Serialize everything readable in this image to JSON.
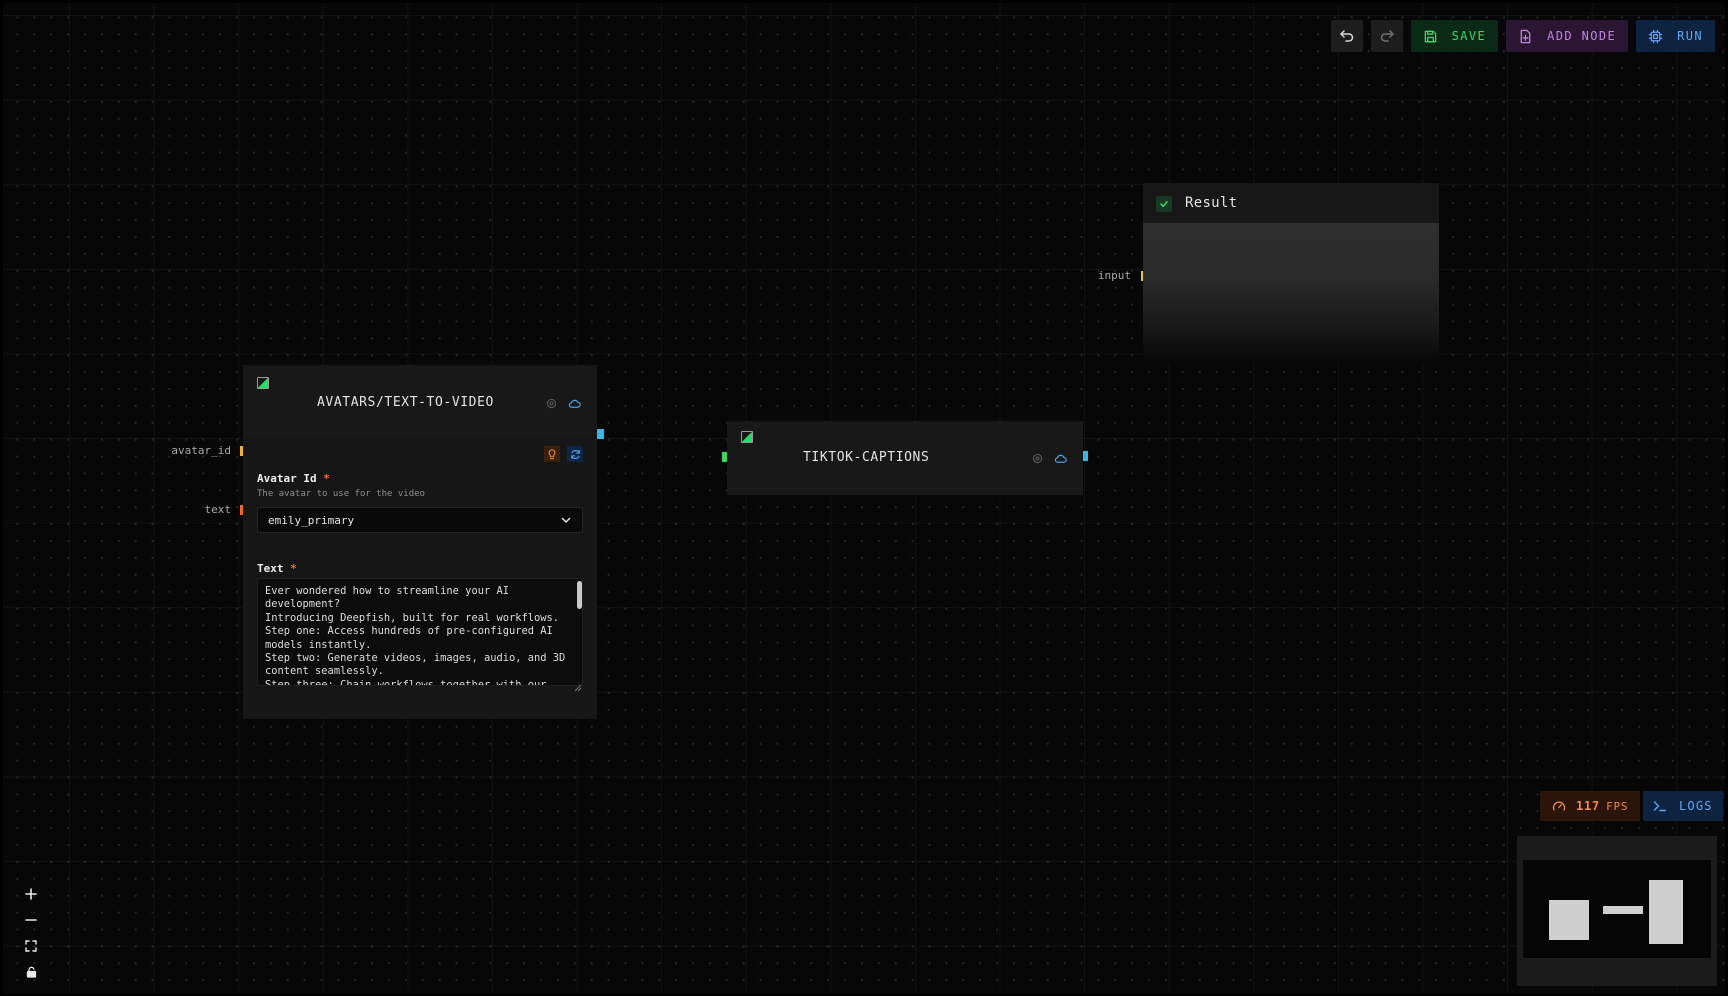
{
  "toolbar": {
    "undo_icon": "undo-icon",
    "redo_icon": "redo-icon",
    "save_label": "SAVE",
    "add_node_label": "ADD NODE",
    "run_label": "RUN"
  },
  "nodes": {
    "text_to_video": {
      "title": "AVATARS/TEXT-TO-VIDEO",
      "inputs": [
        {
          "label": "avatar_id",
          "color": "#f2b23a"
        },
        {
          "label": "text",
          "color": "#ef6a2a"
        }
      ],
      "output_color": "#35b8e8",
      "fields": {
        "avatar": {
          "label": "Avatar Id",
          "required_mark": "*",
          "description": "The avatar to use for the video",
          "value": "emily_primary"
        },
        "text": {
          "label": "Text",
          "required_mark": "*",
          "value": "Ever wondered how to streamline your AI\ndevelopment?\nIntroducing Deepfish, built for real workflows.\nStep one: Access hundreds of pre-configured AI\nmodels instantly.\nStep two: Generate videos, images, audio, and 3D\ncontent seamlessly.\nStep three: Chain workflows together with our"
        }
      }
    },
    "tiktok_captions": {
      "title": "TIKTOK-CAPTIONS",
      "input_color": "#3ed65a",
      "output_color": "#35b8e8"
    },
    "result": {
      "title": "Result",
      "input_label": "input",
      "input_color": "#f2c23a"
    }
  },
  "status": {
    "fps_value": "117",
    "fps_unit": "FPS",
    "logs_label": "LOGS"
  },
  "colors": {
    "accent_green": "#45d36f",
    "accent_purple": "#c184e0",
    "accent_blue": "#5fa6f0",
    "accent_orange": "#ef8a4c"
  }
}
